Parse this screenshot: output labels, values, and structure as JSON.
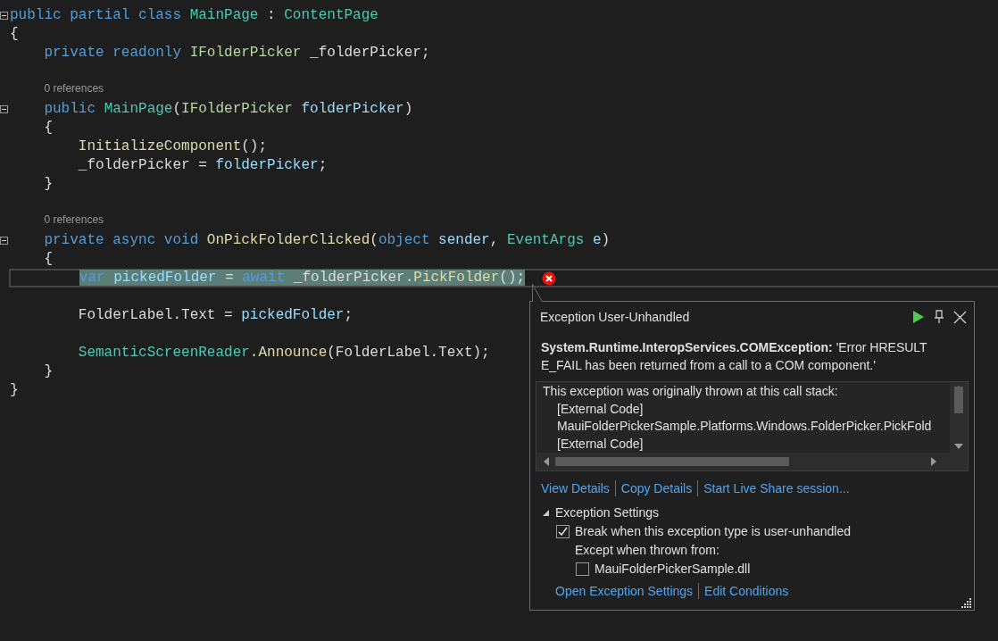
{
  "editor": {
    "lines": [
      {
        "kind": "code",
        "collapsible": true,
        "tokens": [
          {
            "t": "public partial class ",
            "kind": "keyword"
          },
          {
            "t": "MainPage",
            "kind": "type"
          },
          {
            "t": " : ",
            "kind": "plain"
          },
          {
            "t": "ContentPage",
            "kind": "type"
          }
        ]
      },
      {
        "kind": "code",
        "tokens": [
          {
            "t": "{",
            "kind": "plain"
          }
        ]
      },
      {
        "kind": "code",
        "tokens": [
          {
            "t": "    private readonly ",
            "kind": "keyword"
          },
          {
            "t": "IFolderPicker",
            "kind": "interface"
          },
          {
            "t": " _folderPicker;",
            "kind": "plain"
          }
        ]
      },
      {
        "kind": "blank"
      },
      {
        "kind": "codelens",
        "text": "0 references"
      },
      {
        "kind": "code",
        "collapsible": true,
        "tokens": [
          {
            "t": "    public ",
            "kind": "keyword"
          },
          {
            "t": "MainPage",
            "kind": "type"
          },
          {
            "t": "(",
            "kind": "plain"
          },
          {
            "t": "IFolderPicker",
            "kind": "interface"
          },
          {
            "t": " folderPicker",
            "kind": "param"
          },
          {
            "t": ")",
            "kind": "plain"
          }
        ]
      },
      {
        "kind": "code",
        "tokens": [
          {
            "t": "    {",
            "kind": "plain"
          }
        ]
      },
      {
        "kind": "code",
        "tokens": [
          {
            "t": "        InitializeComponent",
            "kind": "method"
          },
          {
            "t": "();",
            "kind": "plain"
          }
        ]
      },
      {
        "kind": "code",
        "tokens": [
          {
            "t": "        _folderPicker = ",
            "kind": "plain"
          },
          {
            "t": "folderPicker",
            "kind": "param"
          },
          {
            "t": ";",
            "kind": "plain"
          }
        ]
      },
      {
        "kind": "code",
        "tokens": [
          {
            "t": "    }",
            "kind": "plain"
          }
        ]
      },
      {
        "kind": "blank"
      },
      {
        "kind": "codelens",
        "text": "0 references"
      },
      {
        "kind": "code",
        "collapsible": true,
        "tokens": [
          {
            "t": "    private async void ",
            "kind": "keyword"
          },
          {
            "t": "OnPickFolderClicked",
            "kind": "method"
          },
          {
            "t": "(",
            "kind": "plain"
          },
          {
            "t": "object ",
            "kind": "keyword"
          },
          {
            "t": "sender",
            "kind": "param"
          },
          {
            "t": ", ",
            "kind": "plain"
          },
          {
            "t": "EventArgs",
            "kind": "type"
          },
          {
            "t": " e",
            "kind": "param"
          },
          {
            "t": ")",
            "kind": "plain"
          }
        ]
      },
      {
        "kind": "code",
        "tokens": [
          {
            "t": "    {",
            "kind": "plain"
          }
        ]
      },
      {
        "kind": "code",
        "current": true,
        "error": true,
        "tokens": [
          {
            "t": "        var ",
            "kind": "keyword"
          },
          {
            "t": "pickedFolder",
            "kind": "param"
          },
          {
            "t": " = ",
            "kind": "plain"
          },
          {
            "t": "await ",
            "kind": "keyword"
          },
          {
            "t": "_folderPicker.",
            "kind": "plain"
          },
          {
            "t": "PickFolder",
            "kind": "method"
          },
          {
            "t": "();",
            "kind": "plain"
          }
        ]
      },
      {
        "kind": "blank"
      },
      {
        "kind": "code",
        "tokens": [
          {
            "t": "        FolderLabel.Text = ",
            "kind": "plain"
          },
          {
            "t": "pickedFolder",
            "kind": "param"
          },
          {
            "t": ";",
            "kind": "plain"
          }
        ]
      },
      {
        "kind": "blank"
      },
      {
        "kind": "code",
        "tokens": [
          {
            "t": "        SemanticScreenReader",
            "kind": "type"
          },
          {
            "t": ".",
            "kind": "plain"
          },
          {
            "t": "Announce",
            "kind": "method"
          },
          {
            "t": "(FolderLabel.Text);",
            "kind": "plain"
          }
        ]
      },
      {
        "kind": "code",
        "tokens": [
          {
            "t": "    }",
            "kind": "plain"
          }
        ]
      },
      {
        "kind": "code",
        "tokens": [
          {
            "t": "}",
            "kind": "plain"
          }
        ]
      }
    ]
  },
  "exception_popup": {
    "title": "Exception User-Unhandled",
    "message": "**System.Runtime.InteropServices.COMException:** 'Error HRESULT E_FAIL has been returned from a call to a COM component.'",
    "stack": [
      {
        "text": "This exception was originally thrown at this call stack:",
        "indented": false
      },
      {
        "text": "[External Code]",
        "indented": true
      },
      {
        "text": "MauiFolderPickerSample.Platforms.Windows.FolderPicker.PickFold",
        "indented": true
      },
      {
        "text": "[External Code]",
        "indented": true
      }
    ],
    "links": [
      "View Details",
      "Copy Details",
      "Start Live Share session..."
    ],
    "settings": {
      "title": "Exception Settings",
      "expanded": true,
      "break_option": {
        "label": "Break when this exception type is user-unhandled",
        "checked": true
      },
      "except_label": "Except when thrown from:",
      "modules": [
        {
          "label": "MauiFolderPickerSample.dll",
          "checked": false
        }
      ]
    },
    "footer_links": [
      "Open Exception Settings",
      "Edit Conditions"
    ]
  }
}
